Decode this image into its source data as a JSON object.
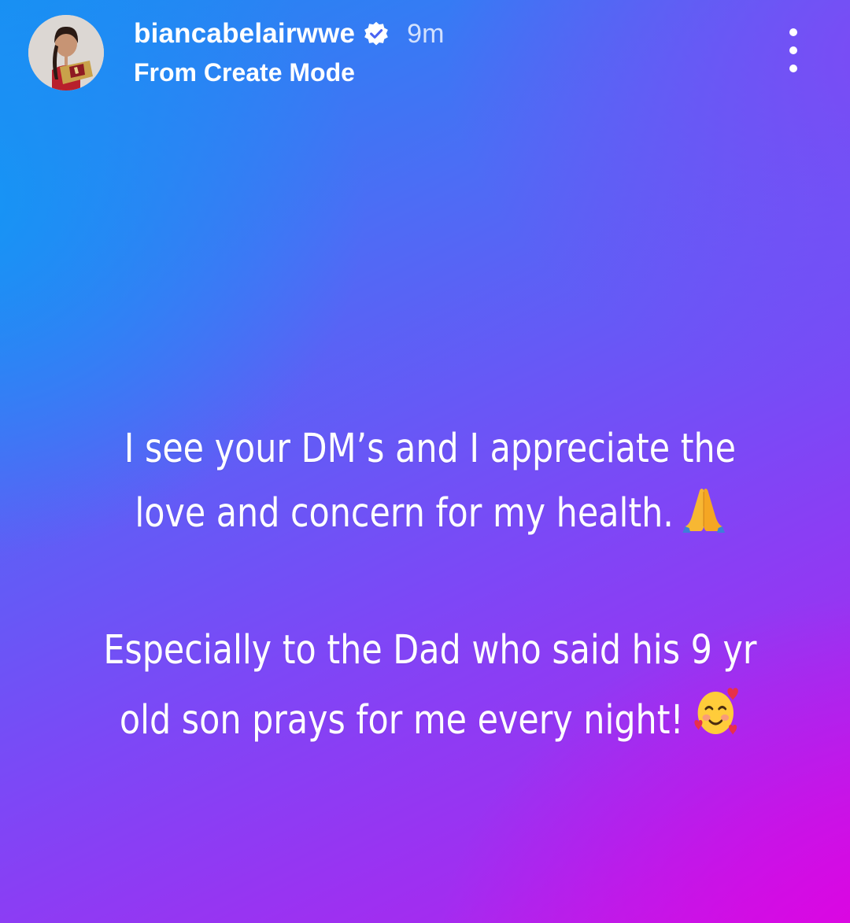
{
  "header": {
    "username": "biancabelairwwe",
    "verified": true,
    "time_ago": "9m",
    "subtitle": "From Create Mode"
  },
  "story": {
    "paragraph1": [
      "I see your DM’s and I appreciate the",
      "love and concern for my health."
    ],
    "paragraph2": [
      "Especially to the Dad who said his 9 yr",
      "old son prays for me every night!"
    ],
    "emoji1": "folded-hands-icon",
    "emoji2": "smiling-face-with-hearts-icon"
  },
  "colors": {
    "gradient_top_left": "#1b8cf2",
    "gradient_mid": "#7c48f6",
    "gradient_bottom_right": "#e200e1",
    "verified_badge": "#ffffff"
  }
}
